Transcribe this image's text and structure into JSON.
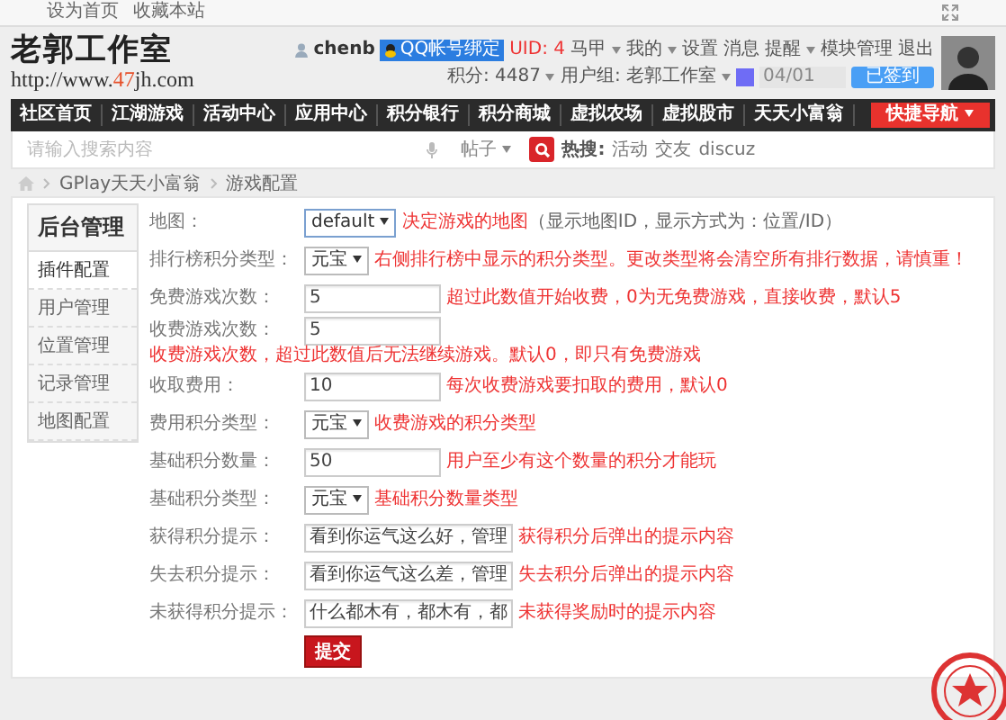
{
  "top_links": [
    "设为首页",
    "收藏本站"
  ],
  "logo": {
    "title": "老郭工作室",
    "url_prefix": "http://www.",
    "url_highlight": "47",
    "url_suffix": "jh.com"
  },
  "user_bar": {
    "username": "chenb",
    "qq_bind": "QQ帐号绑定",
    "uid": "UID: 4",
    "links": [
      {
        "label": "马甲",
        "dropdown": true
      },
      {
        "label": "我的",
        "dropdown": true
      },
      {
        "label": "设置",
        "dropdown": false
      },
      {
        "label": "消息",
        "dropdown": false
      },
      {
        "label": "提醒",
        "dropdown": true
      },
      {
        "label": "模块管理",
        "dropdown": false
      },
      {
        "label": "退出",
        "dropdown": false
      }
    ],
    "points": "积分: 4487",
    "group": "用户组: 老郭工作室",
    "sign_date": "04/01",
    "signed": "已签到"
  },
  "nav": {
    "items": [
      {
        "label": "社区首页"
      },
      {
        "label": "江湖游戏"
      },
      {
        "label": "活动中心"
      },
      {
        "label": "应用中心"
      },
      {
        "label": "积分银行"
      },
      {
        "label": "积分商城"
      },
      {
        "label": "虚拟农场"
      },
      {
        "label": "虚拟股市"
      },
      {
        "label": "天天小富翁"
      }
    ],
    "quick_nav": "快捷导航"
  },
  "search": {
    "placeholder": "请输入搜索内容",
    "scope": "帖子",
    "hot_label": "热搜:",
    "hot": [
      "活动",
      "交友",
      "discuz"
    ]
  },
  "breadcrumb": [
    "GPlay天天小富翁",
    "游戏配置"
  ],
  "sidebar": {
    "title": "后台管理",
    "items": [
      {
        "label": "插件配置",
        "selected": true
      },
      {
        "label": "用户管理",
        "selected": false
      },
      {
        "label": "位置管理",
        "selected": false
      },
      {
        "label": "记录管理",
        "selected": false
      },
      {
        "label": "地图配置",
        "selected": false
      }
    ]
  },
  "form": {
    "rows": [
      {
        "kind": "select",
        "label": "地图：",
        "value": "default",
        "hint": "决定游戏的地图",
        "note": "（显示地图ID，显示方式为：位置/ID）"
      },
      {
        "kind": "select",
        "label": "排行榜积分类型：",
        "value": "元宝",
        "hint": "右侧排行榜中显示的积分类型。更改类型将会清空所有排行数据，请慎重！"
      },
      {
        "kind": "input",
        "label": "免费游戏次数：",
        "value": "5",
        "hint": "超过此数值开始收费，0为无免费游戏，直接收费，默认5"
      },
      {
        "kind": "input",
        "label": "收费游戏次数：",
        "value": "5",
        "hint": "收费游戏次数，超过此数值后无法继续游戏。默认0，即只有免费游戏"
      },
      {
        "kind": "input",
        "label": "收取费用：",
        "value": "10",
        "hint": "每次收费游戏要扣取的费用，默认0"
      },
      {
        "kind": "select",
        "label": "费用积分类型：",
        "value": "元宝",
        "hint": "收费游戏的积分类型"
      },
      {
        "kind": "input",
        "label": "基础积分数量：",
        "value": "50",
        "hint": "用户至少有这个数量的积分才能玩"
      },
      {
        "kind": "select",
        "label": "基础积分类型：",
        "value": "元宝",
        "hint": "基础积分数量类型"
      },
      {
        "kind": "input",
        "label": "获得积分提示：",
        "value": "看到你运气这么好，管理",
        "hint": "获得积分后弹出的提示内容"
      },
      {
        "kind": "input",
        "label": "失去积分提示：",
        "value": "看到你运气这么差，管理",
        "hint": "失去积分后弹出的提示内容"
      },
      {
        "kind": "input",
        "label": "未获得积分提示：",
        "value": "什么都木有，都木有，都",
        "hint": "未获得奖励时的提示内容"
      }
    ],
    "submit": "提交"
  }
}
